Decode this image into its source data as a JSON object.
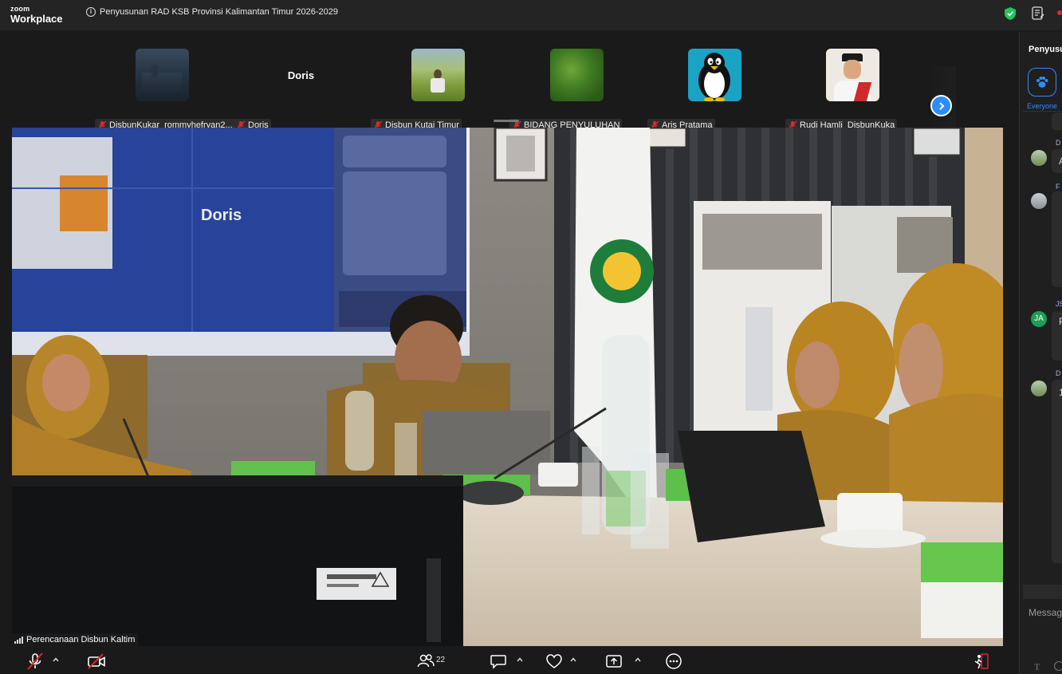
{
  "app": {
    "logo_small": "zoom",
    "logo_big": "Workplace"
  },
  "meeting": {
    "title": "Penyusunan RAD KSB Provinsi Kalimantan Timur 2026-2029"
  },
  "gallery": {
    "tiles": [
      {
        "name": "DisbunKukar_rommyhefryan2...",
        "has_video": true,
        "muted": true
      },
      {
        "name": "Doris",
        "display": "Doris",
        "has_video": false,
        "muted": true
      },
      {
        "name": "Disbun Kutai Timur",
        "has_video": true,
        "muted": true
      },
      {
        "name": "BIDANG PENYULUHAN",
        "has_video": true,
        "muted": true
      },
      {
        "name": "Aris Pratama",
        "has_video": true,
        "muted": true
      },
      {
        "name": "Rudi Hamli_DisbunKuka",
        "has_video": true,
        "muted": true
      }
    ],
    "next_icon": "chevron-right-icon"
  },
  "main_video": {
    "speaker": "Perencanaan Disbun Kaltim",
    "screen_label": "Doris"
  },
  "chat": {
    "title": "Penyusunan RAD KSB",
    "recipient": "Everyone",
    "messages": [
      {
        "sender_initial": "D",
        "text_start": "A"
      },
      {
        "sender_initial": "F",
        "text_start": ""
      },
      {
        "sender_initial": "JS",
        "avatar": "JA",
        "text_start": "P"
      },
      {
        "sender_initial": "D",
        "text_start": "1"
      }
    ],
    "placeholder": "Message Everyone",
    "format_label": "T"
  },
  "toolbar": {
    "participants_count": "22"
  },
  "colors": {
    "accent": "#2d8cff",
    "mute_red": "#e02828",
    "shield_green": "#22c55e"
  }
}
